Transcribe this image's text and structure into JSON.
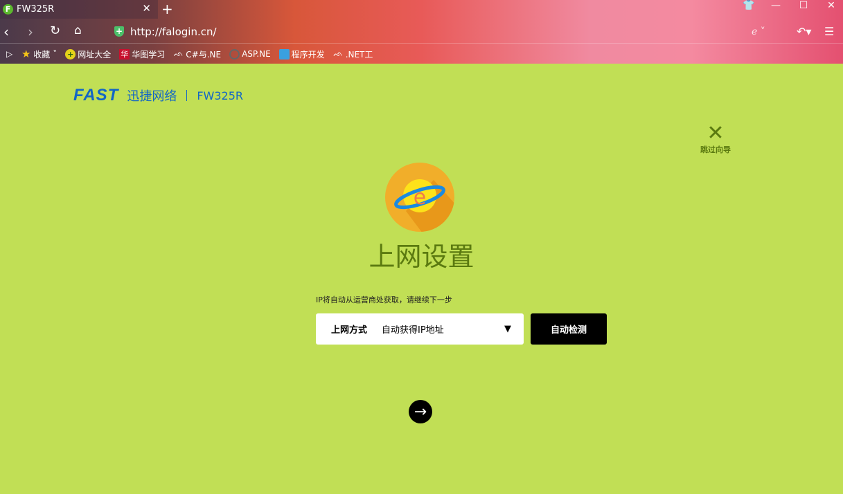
{
  "browser": {
    "tab": {
      "title": "FW325R",
      "favicon": "F"
    },
    "new_tab": "+",
    "url": "http://falogin.cn/",
    "bookmarks": [
      {
        "label": "收藏",
        "icon": "star-icon"
      },
      {
        "label": "网址大全",
        "icon": "plus-circle-icon"
      },
      {
        "label": "华图学习",
        "icon": "huatu-icon"
      },
      {
        "label": "C#与.NE",
        "icon": "csdn-icon"
      },
      {
        "label": "ASP.NE",
        "icon": "ring-icon"
      },
      {
        "label": "程序开发",
        "icon": "cube-icon"
      },
      {
        "label": ".NET工",
        "icon": "csdn-icon"
      }
    ]
  },
  "page": {
    "brand": "FAST",
    "brand_cn": "迅捷网络",
    "model": "FW325R",
    "skip": "跳过向导",
    "title": "上网设置",
    "hint": "IP将自动从运营商处获取，请继续下一步",
    "select": {
      "label": "上网方式",
      "value": "自动获得IP地址"
    },
    "detect_button": "自动检测",
    "colors": {
      "background": "#c1df55",
      "brand": "#1266c5",
      "title": "#5b7a10"
    }
  }
}
